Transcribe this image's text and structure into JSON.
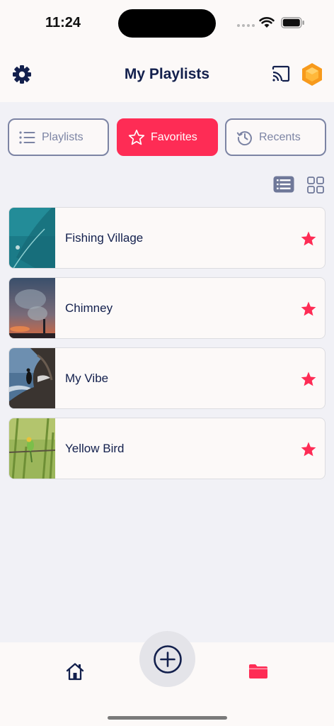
{
  "status_bar": {
    "time": "11:24"
  },
  "header": {
    "title": "My Playlists"
  },
  "tabs": [
    {
      "label": "Playlists",
      "active": false
    },
    {
      "label": "Favorites",
      "active": true
    },
    {
      "label": "Recents",
      "active": false
    }
  ],
  "playlists": [
    {
      "title": "Fishing Village",
      "favorite": true,
      "thumbnail": "teal-sea"
    },
    {
      "title": "Chimney",
      "favorite": true,
      "thumbnail": "smoke-sunset"
    },
    {
      "title": "My Vibe",
      "favorite": true,
      "thumbnail": "bird-on-rock"
    },
    {
      "title": "Yellow Bird",
      "favorite": true,
      "thumbnail": "green-bird"
    }
  ],
  "icons": {
    "settings": "gear-icon",
    "cast": "cast-icon",
    "logo": "hexagon-logo-icon",
    "list_view": "list-view-icon",
    "grid_view": "grid-view-icon",
    "favorite": "star-icon",
    "home": "home-icon",
    "add": "plus-circle-icon",
    "library": "folder-icon"
  },
  "colors": {
    "accent": "#fe2c55",
    "navy": "#13204d",
    "muted": "#7c84a4",
    "background": "#f1f1f6",
    "surface": "#fcf9f8"
  }
}
